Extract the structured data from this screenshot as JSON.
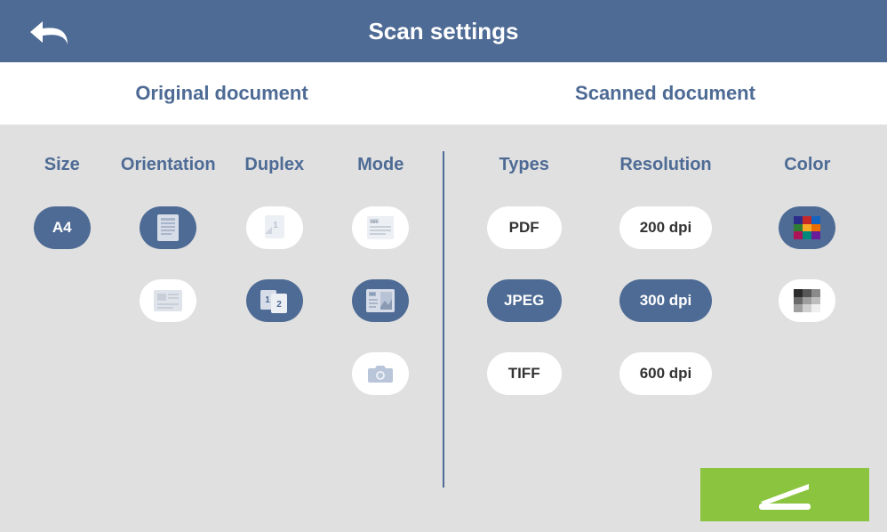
{
  "header": {
    "title": "Scan settings"
  },
  "sections": {
    "original": "Original document",
    "scanned": "Scanned document"
  },
  "columns": {
    "size": "Size",
    "orientation": "Orientation",
    "duplex": "Duplex",
    "mode": "Mode",
    "types": "Types",
    "resolution": "Resolution",
    "color": "Color"
  },
  "size": {
    "options": [
      "A4"
    ],
    "selected": "A4"
  },
  "orientation": {
    "options": [
      "portrait",
      "landscape"
    ],
    "selected": "portrait"
  },
  "duplex": {
    "options": [
      "single-sided",
      "double-sided"
    ],
    "selected": "double-sided"
  },
  "mode": {
    "options": [
      "text",
      "text-photo",
      "photo"
    ],
    "selected": "text-photo"
  },
  "types": {
    "options": [
      "PDF",
      "JPEG",
      "TIFF"
    ],
    "selected": "JPEG"
  },
  "resolution": {
    "options": [
      "200 dpi",
      "300 dpi",
      "600 dpi"
    ],
    "selected": "300 dpi"
  },
  "color": {
    "options": [
      "color",
      "grayscale"
    ],
    "selected": "color"
  }
}
